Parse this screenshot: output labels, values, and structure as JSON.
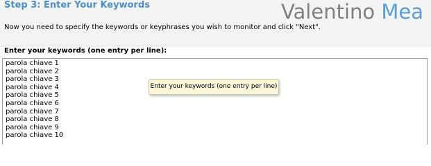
{
  "header": {
    "step_title": "Step 3: Enter Your Keywords",
    "logo_first": "Valentino",
    "logo_last": "Mea",
    "instruction": "Now you need to specify the keywords or keyphrases you wish to monitor and click \"Next\"."
  },
  "keywords_field": {
    "label": "Enter your keywords (one entry per line):",
    "lines": [
      "parola chiave 1",
      "parola chiave 2",
      "parola chiave 3",
      "parola chiave 4",
      "parola chiave 5",
      "parola chiave 6",
      "parola chiave 7",
      "parola chiave 8",
      "parola chiave 9",
      "parola chiave 10"
    ]
  },
  "tooltip": {
    "text": "Enter your keywords (one entry per line)"
  },
  "colors": {
    "accent": "#4d8fc7",
    "logo_grey": "#808080",
    "logo_blue": "#5b9ddb",
    "tooltip_bg": "#fbf5d9"
  }
}
